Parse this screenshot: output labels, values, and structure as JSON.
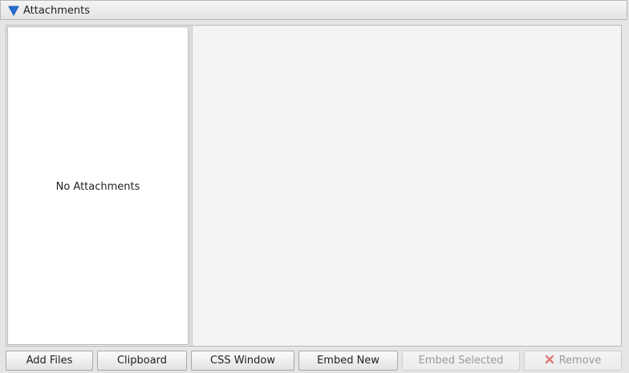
{
  "header": {
    "title": "Attachments"
  },
  "list": {
    "empty_text": "No Attachments"
  },
  "buttons": {
    "add_files": "Add Files",
    "clipboard": "Clipboard",
    "css_window": "CSS Window",
    "embed_new": "Embed New",
    "embed_selected": "Embed Selected",
    "remove": "Remove"
  },
  "icons": {
    "toggle": "triangle-down-icon",
    "remove": "x-icon"
  },
  "colors": {
    "toggle_blue": "#2a6fd0",
    "remove_red": "#d9534f"
  }
}
